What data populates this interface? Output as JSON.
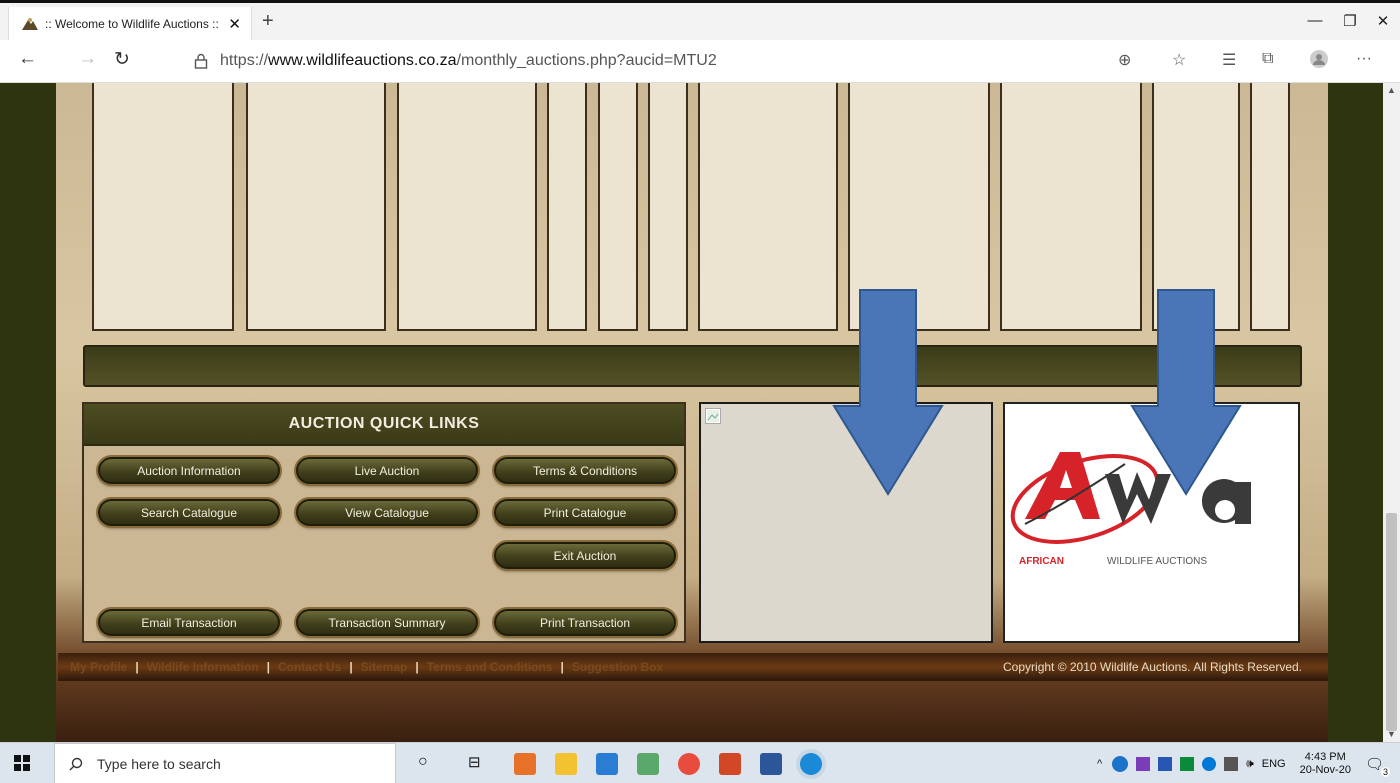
{
  "browser": {
    "tab_title": ":: Welcome to Wildlife Auctions ::",
    "url_prefix": "https://",
    "url_domain": "www.wildlifeauctions.co.za",
    "url_path": "/monthly_auctions.php?aucid=MTU2",
    "icons": [
      "back-arrow-icon",
      "forward-arrow-icon",
      "refresh-icon",
      "lock-icon",
      "zoom-icon",
      "star-icon",
      "favorites-icon",
      "collections-icon",
      "profile-icon",
      "more-icon"
    ]
  },
  "quick_links": {
    "heading": "AUCTION QUICK LINKS",
    "buttons": {
      "auction_information": "Auction Information",
      "live_auction": "Live Auction",
      "terms_conditions": "Terms & Conditions",
      "search_catalogue": "Search Catalogue",
      "view_catalogue": "View Catalogue",
      "print_catalogue": "Print Catalogue",
      "exit_auction": "Exit Auction",
      "email_transaction": "Email Transaction",
      "transaction_summary": "Transaction Summary",
      "print_transaction": "Print Transaction"
    }
  },
  "logo": {
    "mark": "Awa",
    "red_word": "AFRICAN",
    "grey_words": "WILDLIFE AUCTIONS"
  },
  "footer": {
    "links": [
      "My Profile",
      "Wildlife Information",
      "Contact Us",
      "Sitemap",
      "Terms and Conditions",
      "Suggestion Box"
    ],
    "copyright": "Copyright © 2010 Wildlife Auctions. All Rights Reserved."
  },
  "taskbar": {
    "search_placeholder": "Type here to search",
    "language": "ENG",
    "time": "4:43 PM",
    "date": "20-Nov-20",
    "notification_count": "3"
  },
  "colors": {
    "page_bg": "#2f3410",
    "button_olive": "#41401c",
    "arrow_blue": "#4a76b8",
    "logo_red": "#d6232a"
  }
}
